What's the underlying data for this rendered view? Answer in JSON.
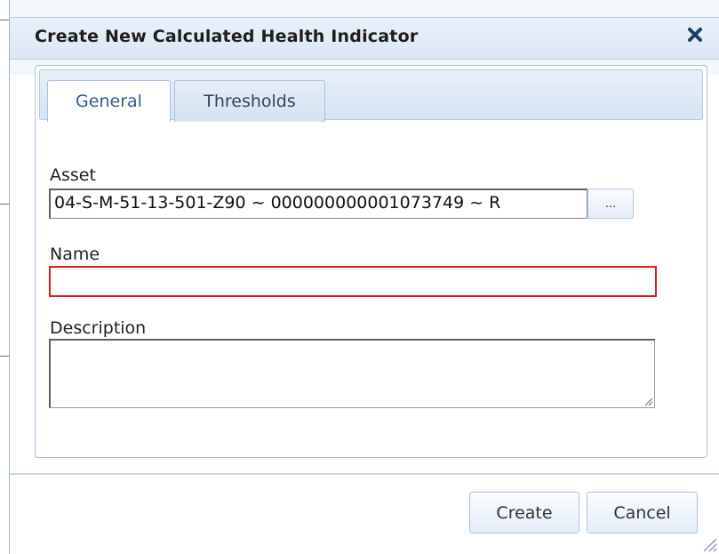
{
  "dialog": {
    "title": "Create New Calculated Health Indicator",
    "close_icon": "close-icon"
  },
  "tabs": [
    {
      "label": "General",
      "active": true
    },
    {
      "label": "Thresholds",
      "active": false
    }
  ],
  "form": {
    "asset_label": "Asset",
    "asset_value": "04-S-M-51-13-501-Z90 ~ 000000000001073749 ~ R",
    "browse_label": "...",
    "name_label": "Name",
    "name_value": "",
    "description_label": "Description",
    "description_value": ""
  },
  "buttons": {
    "create": "Create",
    "cancel": "Cancel"
  },
  "colors": {
    "title_bar": "#dce7f4",
    "border_accent": "#a7bfdc",
    "required_field_border": "#d21f1f"
  }
}
